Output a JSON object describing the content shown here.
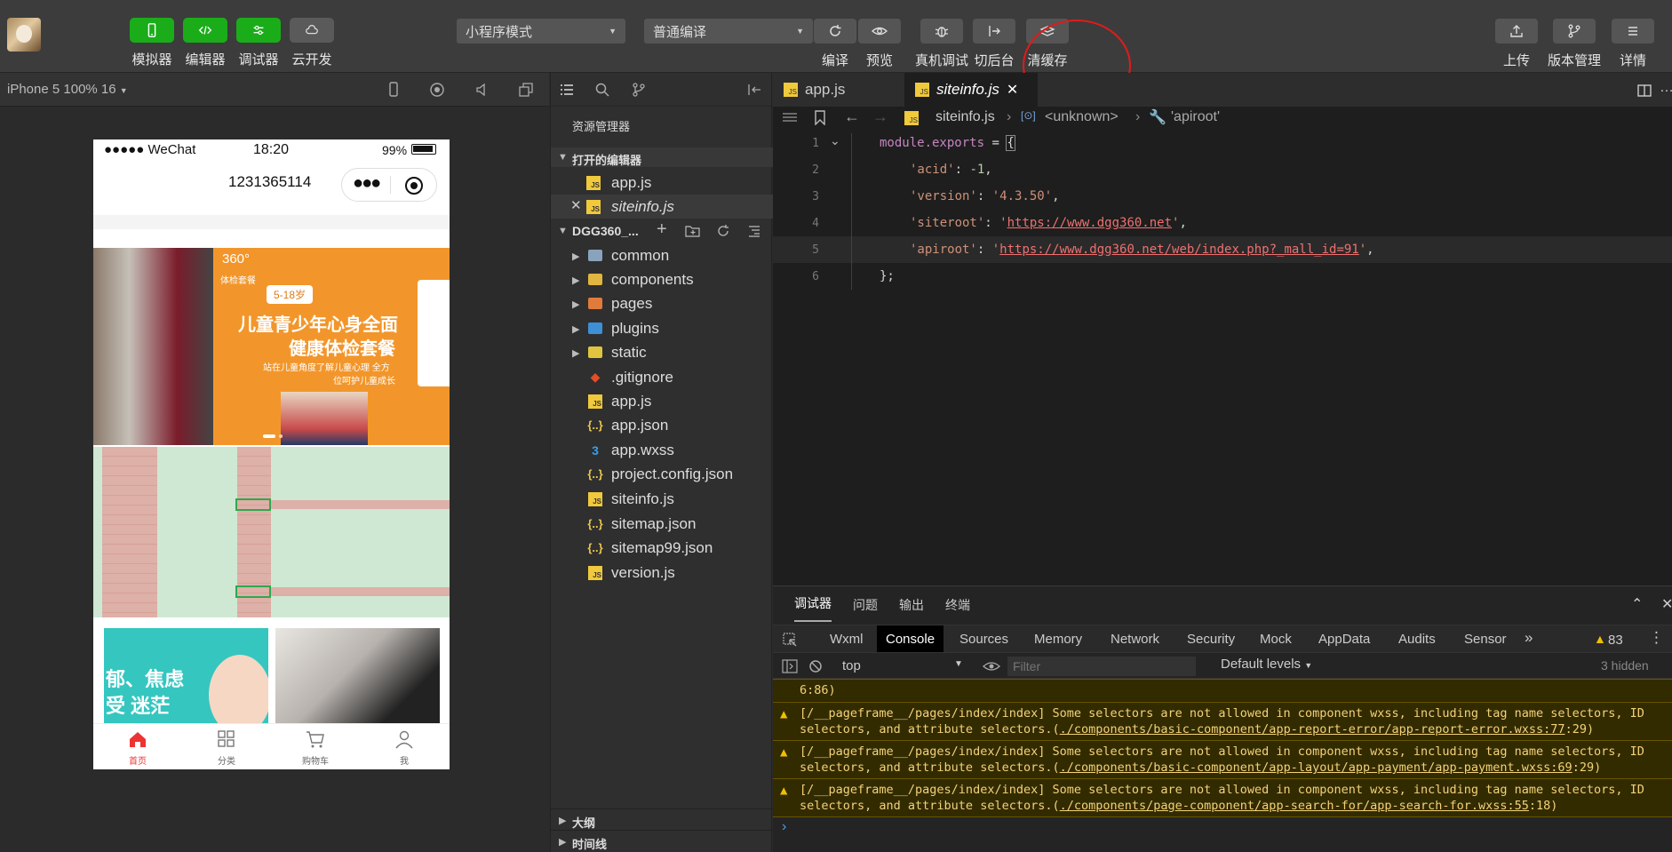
{
  "toolbar": {
    "left_buttons": [
      {
        "label": "模拟器"
      },
      {
        "label": "编辑器"
      },
      {
        "label": "调试器"
      },
      {
        "label": "云开发"
      }
    ],
    "mode_select": "小程序模式",
    "compile_select": "普通编译",
    "mid_buttons": [
      {
        "label": "编译"
      },
      {
        "label": "预览"
      },
      {
        "label": "真机调试"
      },
      {
        "label": "切后台"
      },
      {
        "label": "清缓存"
      }
    ],
    "right_buttons": [
      {
        "label": "上传"
      },
      {
        "label": "版本管理"
      },
      {
        "label": "详情"
      }
    ]
  },
  "simulator": {
    "device": "iPhone 5 100% 16",
    "status_carrier": "●●●●● WeChat",
    "status_time": "18:20",
    "status_battery": "99%",
    "nav_title": "1231365114",
    "banner_badge": "360°",
    "banner_sub": "体检套餐",
    "banner_age": "5-18岁",
    "banner_title1": "儿童青少年心身全面",
    "banner_title2": "健康体检套餐",
    "banner_desc1": "站在儿童角度了解儿童心理 全方",
    "banner_desc2": "位呵护儿童成长",
    "card_text1": "郁、焦虑",
    "card_text2": "受 迷茫",
    "tabbar": [
      {
        "label": "首页"
      },
      {
        "label": "分类"
      },
      {
        "label": "购物车"
      },
      {
        "label": "我"
      }
    ]
  },
  "explorer": {
    "title": "资源管理器",
    "open_editors_label": "打开的编辑器",
    "open_editors": [
      {
        "name": "app.js"
      },
      {
        "name": "siteinfo.js"
      }
    ],
    "project": "DGG360_...",
    "folders": [
      {
        "name": "common"
      },
      {
        "name": "components"
      },
      {
        "name": "pages"
      },
      {
        "name": "plugins"
      },
      {
        "name": "static"
      }
    ],
    "files": [
      {
        "name": ".gitignore"
      },
      {
        "name": "app.js"
      },
      {
        "name": "app.json"
      },
      {
        "name": "app.wxss"
      },
      {
        "name": "project.config.json"
      },
      {
        "name": "siteinfo.js"
      },
      {
        "name": "sitemap.json"
      },
      {
        "name": "sitemap99.json"
      },
      {
        "name": "version.js"
      }
    ],
    "outline": "大纲",
    "timeline": "时间线"
  },
  "editor": {
    "tabs": [
      {
        "name": "app.js"
      },
      {
        "name": "siteinfo.js"
      }
    ],
    "breadcrumb": {
      "file": "siteinfo.js",
      "unknown": "<unknown>",
      "prop": "'apiroot'"
    },
    "lines": [
      "1",
      "2",
      "3",
      "4",
      "5",
      "6"
    ],
    "code": {
      "l1a": "module.exports",
      "l1b": " = ",
      "l1c": "{",
      "acid_k": "'acid'",
      "acid_v": "-1",
      "ver_k": "'version'",
      "ver_v": "'4.3.50'",
      "site_k": "'siteroot'",
      "site_v": "https://www.dgg360.net",
      "api_k": "'apiroot'",
      "api_v": "https://www.dgg360.net/web/index.php?_mall_id=91",
      "close": "};"
    }
  },
  "panel": {
    "tabs": [
      {
        "label": "调试器"
      },
      {
        "label": "问题"
      },
      {
        "label": "输出"
      },
      {
        "label": "终端"
      }
    ],
    "devtabs": [
      {
        "label": "Wxml"
      },
      {
        "label": "Console"
      },
      {
        "label": "Sources"
      },
      {
        "label": "Memory"
      },
      {
        "label": "Network"
      },
      {
        "label": "Security"
      },
      {
        "label": "Mock"
      },
      {
        "label": "AppData"
      },
      {
        "label": "Audits"
      },
      {
        "label": "Sensor"
      }
    ],
    "warn_count": "83",
    "context": "top",
    "filter_placeholder": "Filter",
    "levels": "Default levels",
    "hidden": "3 hidden",
    "prev_line": "6:86)",
    "warnings": [
      {
        "a": "[/__pageframe__/pages/index/index] Some selectors are not allowed in component wxss, including tag name selectors, ID",
        "b": "selectors, and attribute selectors.(",
        "link": "./components/basic-component/app-report-error/app-report-error.wxss:77",
        "c": ":29)"
      },
      {
        "a": "[/__pageframe__/pages/index/index] Some selectors are not allowed in component wxss, including tag name selectors, ID",
        "b": "selectors, and attribute selectors.(",
        "link": "./components/basic-component/app-layout/app-payment/app-payment.wxss:69",
        "c": ":29)"
      },
      {
        "a": "[/__pageframe__/pages/index/index] Some selectors are not allowed in component wxss, including tag name selectors, ID",
        "b": "selectors, and attribute selectors.(",
        "link": "./components/page-component/app-search-for/app-search-for.wxss:55",
        "c": ":18)"
      }
    ]
  }
}
